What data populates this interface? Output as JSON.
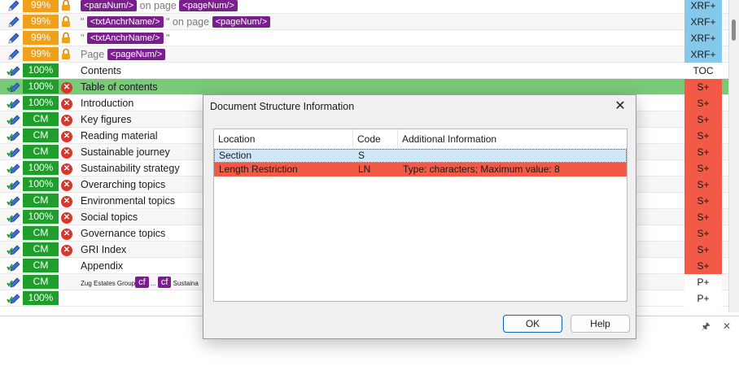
{
  "rows": [
    {
      "pct": "99%",
      "pct_color": "orange",
      "status": "lock",
      "src": [
        {
          "tag": "<paraNum/>"
        },
        {
          "gray": " on page "
        },
        {
          "tag": "<pageNum/>"
        }
      ],
      "right": "XRF+",
      "right_type": "xrf"
    },
    {
      "pct": "99%",
      "pct_color": "orange",
      "status": "lock",
      "src": [
        {
          "gray": "\" "
        },
        {
          "tag": "<txtAnchrName/>"
        },
        {
          "gray": " \" on page "
        },
        {
          "tag": "<pageNum/>"
        }
      ],
      "right": "XRF+",
      "right_type": "xrf"
    },
    {
      "pct": "99%",
      "pct_color": "orange",
      "status": "lock",
      "src": [
        {
          "gray": "\" "
        },
        {
          "tag": "<txtAnchrName/>"
        },
        {
          "gray": " \""
        }
      ],
      "right": "XRF+",
      "right_type": "xrf"
    },
    {
      "pct": "99%",
      "pct_color": "orange",
      "status": "lock",
      "src": [
        {
          "gray": "Page "
        },
        {
          "tag": "<pageNum/>"
        }
      ],
      "right": "XRF+",
      "right_type": "xrf"
    },
    {
      "pct": "100%",
      "pct_color": "green",
      "status": "",
      "src": [
        {
          "text": "Contents"
        }
      ],
      "right": "TOC",
      "right_type": "toc"
    },
    {
      "pct": "100%",
      "pct_color": "green",
      "status": "error",
      "src": [
        {
          "text": "Table of contents"
        }
      ],
      "right": "S+",
      "right_type": "s",
      "selected": true
    },
    {
      "pct": "100%",
      "pct_color": "green",
      "status": "error",
      "src": [
        {
          "text": "Introduction"
        }
      ],
      "right": "S+",
      "right_type": "s"
    },
    {
      "pct": "CM",
      "pct_color": "green",
      "status": "error",
      "src": [
        {
          "text": "Key figures"
        }
      ],
      "right": "S+",
      "right_type": "s"
    },
    {
      "pct": "CM",
      "pct_color": "green",
      "status": "error",
      "src": [
        {
          "text": "Reading material"
        }
      ],
      "right": "S+",
      "right_type": "s"
    },
    {
      "pct": "CM",
      "pct_color": "green",
      "status": "error",
      "src": [
        {
          "text": "Sustainable journey"
        }
      ],
      "right": "S+",
      "right_type": "s"
    },
    {
      "pct": "100%",
      "pct_color": "green",
      "status": "error",
      "src": [
        {
          "text": "Sustainability strategy"
        }
      ],
      "right": "S+",
      "right_type": "s"
    },
    {
      "pct": "100%",
      "pct_color": "green",
      "status": "error",
      "src": [
        {
          "text": "Overarching topics"
        }
      ],
      "right": "S+",
      "right_type": "s"
    },
    {
      "pct": "CM",
      "pct_color": "green",
      "status": "error",
      "src": [
        {
          "text": "Environmental topics"
        }
      ],
      "right": "S+",
      "right_type": "s"
    },
    {
      "pct": "100%",
      "pct_color": "green",
      "status": "error",
      "src": [
        {
          "text": "Social topics"
        }
      ],
      "right": "S+",
      "right_type": "s"
    },
    {
      "pct": "CM",
      "pct_color": "green",
      "status": "error",
      "src": [
        {
          "text": "Governance topics"
        }
      ],
      "right": "S+",
      "right_type": "s"
    },
    {
      "pct": "CM",
      "pct_color": "green",
      "status": "error",
      "src": [
        {
          "text": "GRI Index"
        }
      ],
      "right": "S+",
      "right_type": "s"
    },
    {
      "pct": "CM",
      "pct_color": "green",
      "status": "",
      "src": [
        {
          "text": "Appendix"
        }
      ],
      "right": "S+",
      "right_type": "s"
    },
    {
      "pct": "CM",
      "pct_color": "green",
      "status": "",
      "src": [
        {
          "small": "Zug Estates Group"
        },
        {
          "tag": "cf"
        },
        {
          "small": " ... "
        },
        {
          "tag": "cf"
        },
        {
          "small": " Sustaina"
        }
      ],
      "right": "P+",
      "right_type": "p"
    },
    {
      "pct": "100%",
      "pct_color": "green",
      "status": "",
      "src": [],
      "right": "P+",
      "right_type": "p"
    }
  ],
  "colors": {
    "xrf": "#86c8ea",
    "s": "#f25a47",
    "selected_row": "#78c978",
    "orange": "#f0a11c",
    "green": "#1f9e2c",
    "tag": "#7a1e8e"
  },
  "bottom_pane": {
    "pin_icon": "pin-icon",
    "close_icon": "close-icon"
  },
  "dialog": {
    "title": "Document Structure Information",
    "close_label": "✕",
    "columns": [
      "Location",
      "Code",
      "Additional Information"
    ],
    "rows": [
      {
        "location": "Section",
        "code": "S",
        "info": ""
      },
      {
        "location": "Length Restriction",
        "code": "LN",
        "info": "Type: characters; Maximum value: 8"
      }
    ],
    "ok_label": "OK",
    "help_label": "Help"
  }
}
